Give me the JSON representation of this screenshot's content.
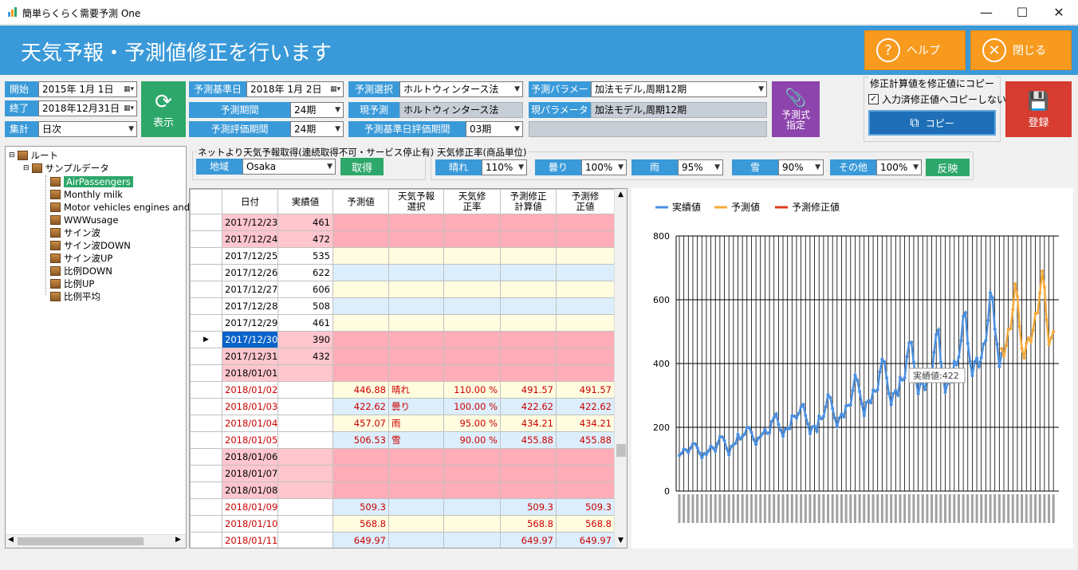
{
  "window": {
    "title": "簡単らくらく需要予測 One",
    "min": "—",
    "max": "☐",
    "close": "✕"
  },
  "header": {
    "title": "天気予報・予測値修正を行います",
    "help": "ヘルプ",
    "close": "閉じる"
  },
  "form": {
    "start_label": "開始",
    "start_value": "2015年  1月  1日",
    "end_label": "終了",
    "end_value": "2018年12月31日",
    "agg_label": "集計",
    "agg_value": "日次",
    "show_button": "表示",
    "base_date_label": "予測基準日",
    "base_date_value": "2018年  1月  2日",
    "period_label": "予測期間",
    "period_value": "24期",
    "eval_label": "予測評価期間",
    "eval_value": "24期",
    "method_label": "予測選択",
    "method_value": "ホルトウィンタース法",
    "current_label": "現予測",
    "current_value": "ホルトウィンタース法",
    "base_eval_label": "予測基準日評価期間",
    "base_eval_value": "03期",
    "param_label": "予測パラメータ",
    "param_value": "加法モデル,周期12期",
    "cur_param_label": "現パラメータ",
    "cur_param_value": "加法モデル,周期12期",
    "formula_button": "予測式\n指定",
    "copy_group_title": "修正計算値を修正値にコピー",
    "copy_checkbox": "入力済修正値へコピーしない",
    "copy_button": "コピー",
    "register_button": "登録"
  },
  "weather": {
    "net_title": "ネットより天気予報取得(連続取得不可・サービス停止有)",
    "region_label": "地域",
    "region_value": "Osaka",
    "fetch_button": "取得",
    "rate_title": "天気修正率(商品単位)",
    "sunny_label": "晴れ",
    "sunny_value": "110%",
    "cloudy_label": "曇り",
    "cloudy_value": "100%",
    "rain_label": "雨",
    "rain_value": "95%",
    "snow_label": "雪",
    "snow_value": "90%",
    "other_label": "その他",
    "other_value": "100%",
    "apply_button": "反映"
  },
  "tree": {
    "root": "ルート",
    "folder": "サンプルデータ",
    "items": [
      "AirPassengers",
      "Monthly milk",
      "Motor vehicles engines and p",
      "WWWusage",
      "サイン波",
      "サイン波DOWN",
      "サイン波UP",
      "比例DOWN",
      "比例UP",
      "比例平均"
    ]
  },
  "grid": {
    "headers": [
      "日付",
      "実績値",
      "予測値",
      "天気予報\n選択",
      "天気修\n正率",
      "予測修正\n計算値",
      "予測修\n正値"
    ],
    "rows": [
      {
        "d": "2017/12/23",
        "a": "461",
        "p": "",
        "w": "",
        "r": "",
        "c": "",
        "v": "",
        "style": "pink"
      },
      {
        "d": "2017/12/24",
        "a": "472",
        "p": "",
        "w": "",
        "r": "",
        "c": "",
        "v": "",
        "style": "pink"
      },
      {
        "d": "2017/12/25",
        "a": "535",
        "p": "",
        "w": "",
        "r": "",
        "c": "",
        "v": "",
        "style": "yellow"
      },
      {
        "d": "2017/12/26",
        "a": "622",
        "p": "",
        "w": "",
        "r": "",
        "c": "",
        "v": "",
        "style": "blue"
      },
      {
        "d": "2017/12/27",
        "a": "606",
        "p": "",
        "w": "",
        "r": "",
        "c": "",
        "v": "",
        "style": "yellow"
      },
      {
        "d": "2017/12/28",
        "a": "508",
        "p": "",
        "w": "",
        "r": "",
        "c": "",
        "v": "",
        "style": "blue"
      },
      {
        "d": "2017/12/29",
        "a": "461",
        "p": "",
        "w": "",
        "r": "",
        "c": "",
        "v": "",
        "style": "yellow"
      },
      {
        "d": "2017/12/30",
        "a": "390",
        "p": "",
        "w": "",
        "r": "",
        "c": "",
        "v": "",
        "style": "pink",
        "sel": true
      },
      {
        "d": "2017/12/31",
        "a": "432",
        "p": "",
        "w": "",
        "r": "",
        "c": "",
        "v": "",
        "style": "pink"
      },
      {
        "d": "2018/01/01",
        "a": "",
        "p": "",
        "w": "",
        "r": "",
        "c": "",
        "v": "",
        "style": "pink"
      },
      {
        "d": "2018/01/02",
        "a": "",
        "p": "446.88",
        "w": "晴れ",
        "r": "110.00 %",
        "c": "491.57",
        "v": "491.57",
        "style": "yellow",
        "red": true
      },
      {
        "d": "2018/01/03",
        "a": "",
        "p": "422.62",
        "w": "曇り",
        "r": "100.00 %",
        "c": "422.62",
        "v": "422.62",
        "style": "blue",
        "red": true
      },
      {
        "d": "2018/01/04",
        "a": "",
        "p": "457.07",
        "w": "雨",
        "r": "95.00 %",
        "c": "434.21",
        "v": "434.21",
        "style": "yellow",
        "red": true
      },
      {
        "d": "2018/01/05",
        "a": "",
        "p": "506.53",
        "w": "雪",
        "r": "90.00 %",
        "c": "455.88",
        "v": "455.88",
        "style": "blue",
        "red": true
      },
      {
        "d": "2018/01/06",
        "a": "",
        "p": "",
        "w": "",
        "r": "",
        "c": "",
        "v": "",
        "style": "pink"
      },
      {
        "d": "2018/01/07",
        "a": "",
        "p": "",
        "w": "",
        "r": "",
        "c": "",
        "v": "",
        "style": "pink"
      },
      {
        "d": "2018/01/08",
        "a": "",
        "p": "",
        "w": "",
        "r": "",
        "c": "",
        "v": "",
        "style": "pink"
      },
      {
        "d": "2018/01/09",
        "a": "",
        "p": "509.3",
        "w": "",
        "r": "",
        "c": "509.3",
        "v": "509.3",
        "style": "blue",
        "red": true
      },
      {
        "d": "2018/01/10",
        "a": "",
        "p": "568.8",
        "w": "",
        "r": "",
        "c": "568.8",
        "v": "568.8",
        "style": "yellow",
        "red": true
      },
      {
        "d": "2018/01/11",
        "a": "",
        "p": "649.97",
        "w": "",
        "r": "",
        "c": "649.97",
        "v": "649.97",
        "style": "blue",
        "red": true
      }
    ]
  },
  "chart_data": {
    "type": "line",
    "legend": [
      "実績値",
      "予測値",
      "予測修正値"
    ],
    "colors": {
      "actual": "#4a8fe0",
      "forecast": "#f4a93b",
      "corrected": "#e03c1c"
    },
    "ylim": [
      0,
      800
    ],
    "yticks": [
      "0",
      "200",
      "400",
      "600",
      "800"
    ],
    "tooltip": "実績値:422",
    "series": [
      {
        "name": "実績値",
        "values": [
          112,
          118,
          132,
          129,
          121,
          135,
          148,
          148,
          136,
          119,
          104,
          118,
          115,
          126,
          141,
          135,
          125,
          149,
          170,
          170,
          158,
          133,
          114,
          140,
          145,
          150,
          178,
          163,
          172,
          178,
          199,
          199,
          184,
          162,
          146,
          166,
          171,
          180,
          193,
          181,
          183,
          218,
          230,
          242,
          209,
          191,
          172,
          194,
          196,
          196,
          236,
          235,
          229,
          243,
          264,
          272,
          237,
          211,
          180,
          201,
          204,
          188,
          235,
          227,
          234,
          264,
          302,
          293,
          259,
          229,
          203,
          229,
          242,
          233,
          267,
          269,
          270,
          315,
          364,
          347,
          312,
          274,
          237,
          278,
          284,
          277,
          317,
          313,
          318,
          374,
          413,
          405,
          355,
          306,
          271,
          306,
          315,
          301,
          356,
          348,
          355,
          422,
          465,
          467,
          404,
          347,
          305,
          336,
          340,
          318,
          362,
          348,
          363,
          435,
          491,
          505,
          404,
          359,
          310,
          337,
          360,
          342,
          406,
          396,
          420,
          472,
          548,
          559,
          463,
          407,
          362,
          405,
          417,
          391,
          419,
          461,
          472,
          535,
          622,
          606,
          508,
          461,
          390,
          432
        ]
      },
      {
        "name": "予測値",
        "values": [
          447,
          423,
          457,
          507,
          509,
          569,
          650,
          611,
          516,
          447,
          417,
          464,
          480,
          468,
          505,
          557,
          559,
          621,
          690,
          640,
          537,
          460,
          480,
          500
        ]
      }
    ],
    "x_labels_note": "rotated dates 2017/08/12 … 2018/02/05"
  }
}
